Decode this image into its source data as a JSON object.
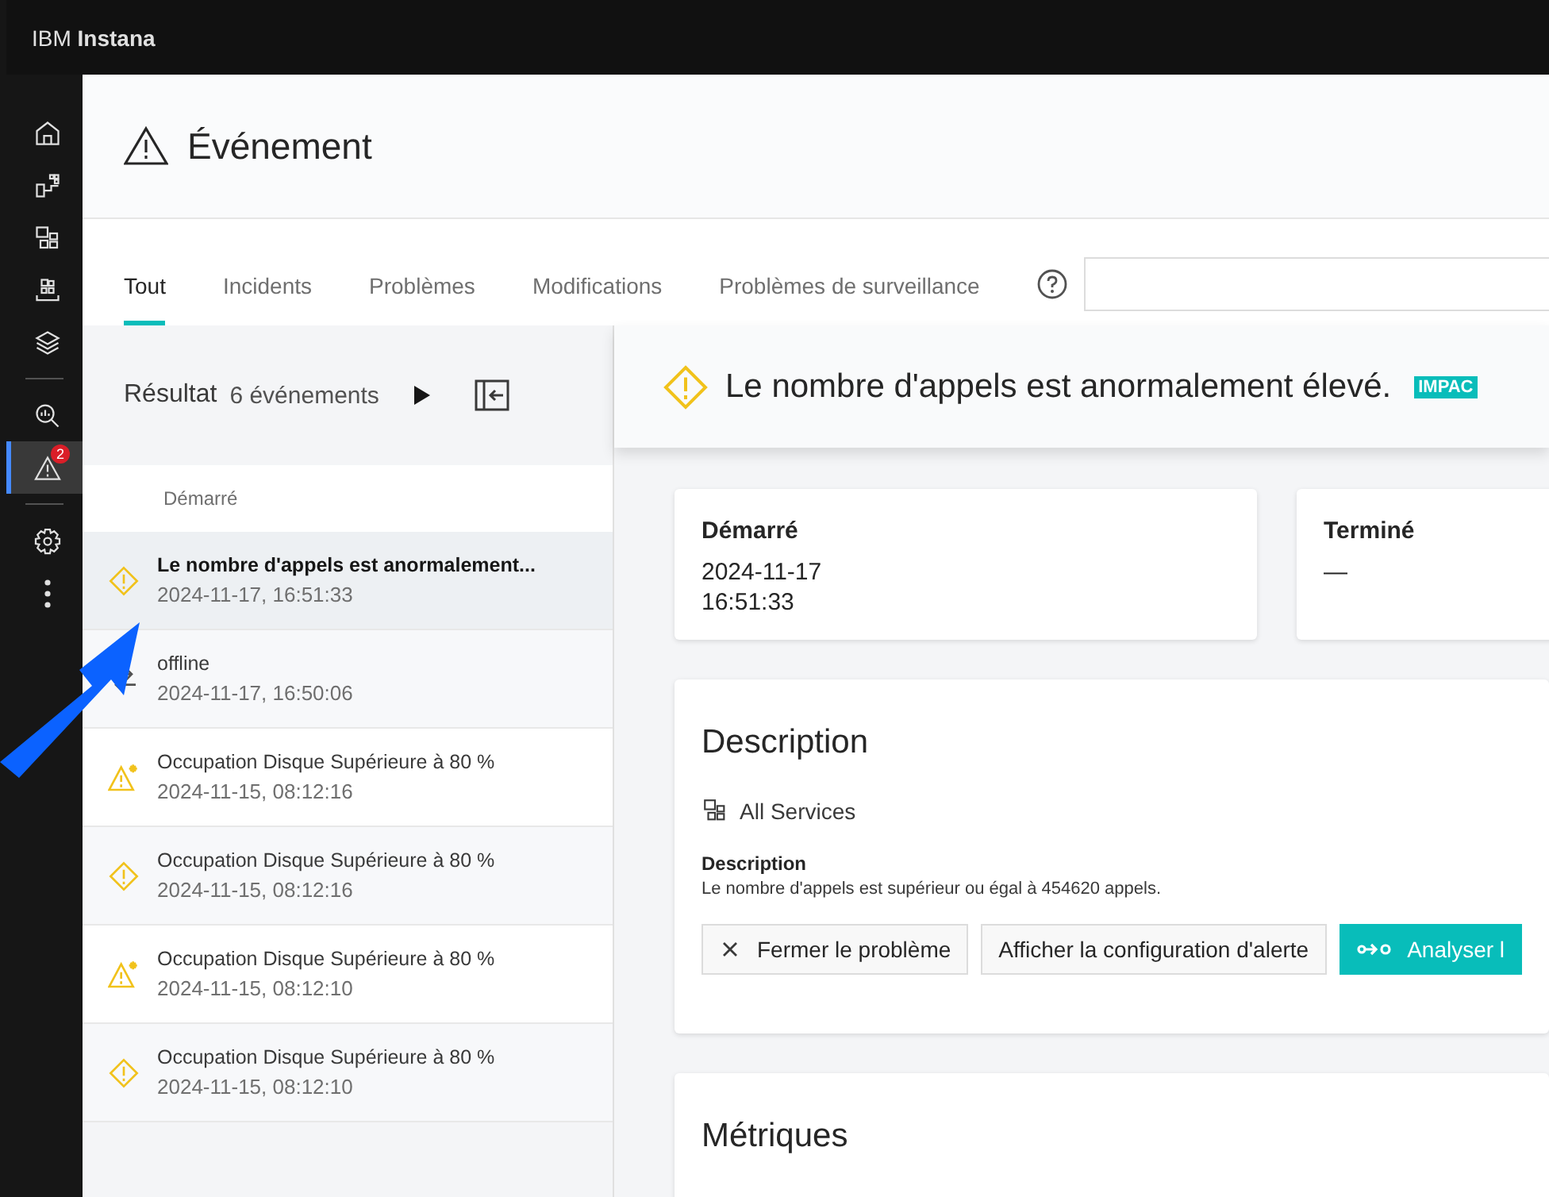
{
  "app": {
    "brand": "IBM **Instana**"
  },
  "nav": {
    "items": [
      {
        "kind": "home",
        "selected": false
      },
      {
        "kind": "dashboard",
        "selected": false
      },
      {
        "kind": "services",
        "selected": false
      },
      {
        "kind": "infrastructure",
        "selected": false
      },
      {
        "kind": "layers",
        "selected": false
      },
      {
        "kind": "divider"
      },
      {
        "kind": "analyze",
        "selected": false
      },
      {
        "kind": "events",
        "selected": true,
        "badge": "2"
      },
      {
        "kind": "divider"
      },
      {
        "kind": "settings",
        "selected": false
      },
      {
        "kind": "more",
        "selected": false
      }
    ]
  },
  "header": {
    "title": "Événement"
  },
  "tabs": [
    {
      "label": "Tout",
      "selected": true
    },
    {
      "label": "Incidents",
      "selected": false
    },
    {
      "label": "Problèmes",
      "selected": false
    },
    {
      "label": "Modifications",
      "selected": false
    },
    {
      "label": "Problèmes de surveillance",
      "selected": false
    }
  ],
  "list": {
    "result_label": "Résultat",
    "result_count": "6 événements",
    "column": "Démarré",
    "rows": [
      {
        "kind": "diamond",
        "title": "Le nombre d'appels est anormalement...",
        "time": "2024-11-17, 16:51:33",
        "selected": true
      },
      {
        "kind": "change",
        "title": "offline",
        "time": "2024-11-17, 16:50:06",
        "selected": false
      },
      {
        "kind": "triangle",
        "title": "Occupation Disque Supérieure à 80 %",
        "time": "2024-11-15, 08:12:16",
        "selected": false
      },
      {
        "kind": "diamond",
        "title": "Occupation Disque Supérieure à 80 %",
        "time": "2024-11-15, 08:12:16",
        "selected": false
      },
      {
        "kind": "triangle",
        "title": "Occupation Disque Supérieure à 80 %",
        "time": "2024-11-15, 08:12:10",
        "selected": false
      },
      {
        "kind": "diamond",
        "title": "Occupation Disque Supérieure à 80 %",
        "time": "2024-11-15, 08:12:10",
        "selected": false
      }
    ]
  },
  "detail": {
    "title": "Le nombre d'appels est anormalement élevé.",
    "badge": "IMPAC",
    "started": {
      "label": "Démarré",
      "lines": [
        "2024-11-17",
        "16:51:33"
      ]
    },
    "ended": {
      "label": "Terminé",
      "lines": [
        "—"
      ]
    },
    "description": {
      "heading": "Description",
      "service": "All Services",
      "label": "Description",
      "text": "Le nombre d'appels est supérieur ou égal à 454620 appels.",
      "buttons": [
        {
          "kind": "close",
          "label": "Fermer le problème"
        },
        {
          "kind": "plain",
          "label": "Afficher la configuration d'alerte"
        },
        {
          "kind": "primary",
          "label": "Analyser l"
        }
      ]
    },
    "metrics": {
      "heading": "Métriques"
    }
  }
}
